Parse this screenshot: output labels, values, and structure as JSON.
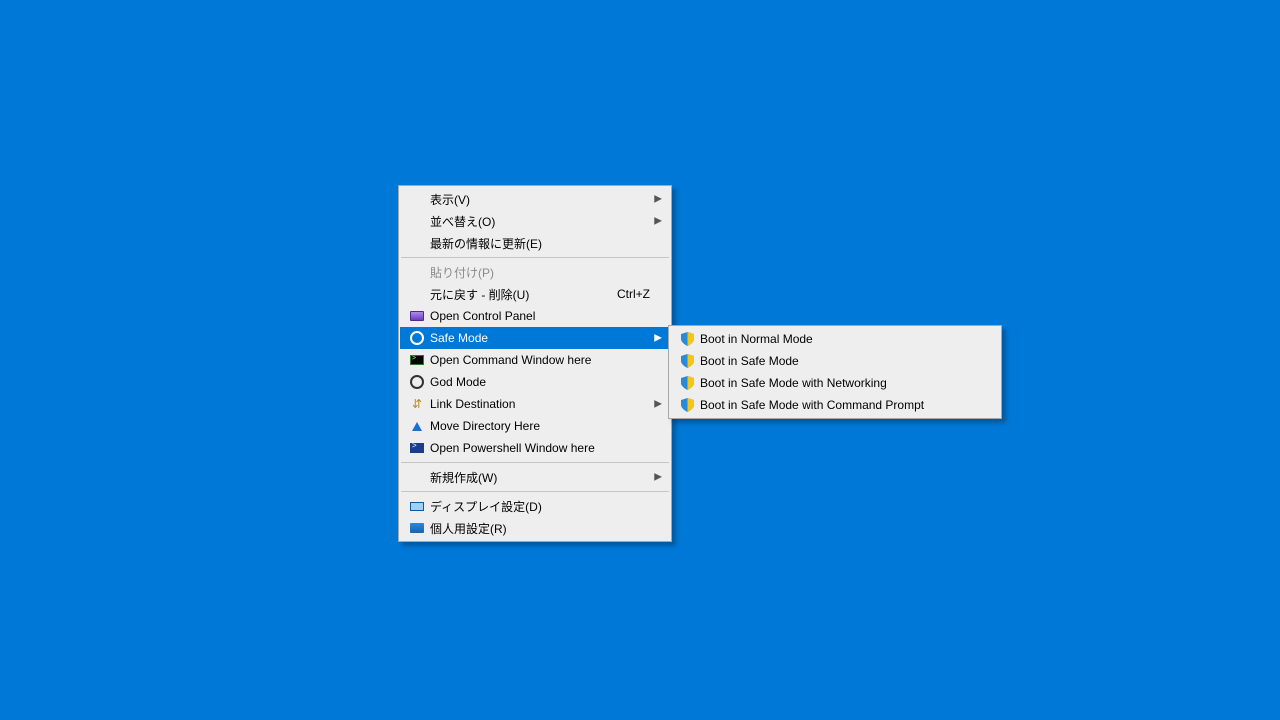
{
  "main_menu": {
    "view": {
      "label": "表示(V)"
    },
    "sort": {
      "label": "並べ替え(O)"
    },
    "refresh": {
      "label": "最新の情報に更新(E)"
    },
    "paste": {
      "label": "貼り付け(P)"
    },
    "undo": {
      "label": "元に戻す - 削除(U)",
      "shortcut": "Ctrl+Z"
    },
    "ctrlpanel": {
      "label": "Open Control Panel"
    },
    "safemode": {
      "label": "Safe Mode"
    },
    "cmdhere": {
      "label": "Open Command Window here"
    },
    "godmode": {
      "label": "God Mode"
    },
    "linkdest": {
      "label": "Link Destination"
    },
    "movedir": {
      "label": "Move Directory Here"
    },
    "pshere": {
      "label": "Open Powershell Window here"
    },
    "new": {
      "label": "新規作成(W)"
    },
    "display": {
      "label": "ディスプレイ設定(D)"
    },
    "personalize": {
      "label": "個人用設定(R)"
    }
  },
  "sub_menu": {
    "boot_normal": {
      "label": "Boot in Normal Mode"
    },
    "boot_safe": {
      "label": "Boot in Safe Mode"
    },
    "boot_safenw": {
      "label": "Boot in Safe Mode with Networking"
    },
    "boot_safecmd": {
      "label": "Boot in Safe Mode with Command Prompt"
    }
  }
}
